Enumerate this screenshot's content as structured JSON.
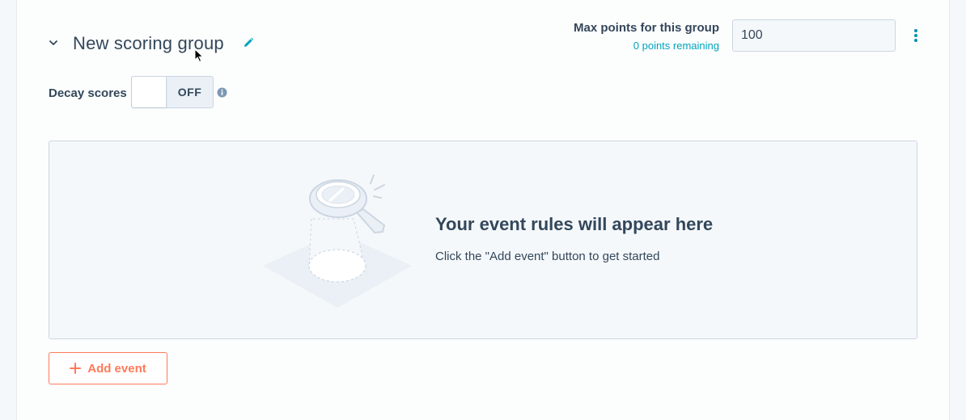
{
  "group": {
    "title": "New scoring group",
    "max_points_label": "Max points for this group",
    "points_remaining": "0 points remaining",
    "max_points_value": "100"
  },
  "decay": {
    "label": "Decay scores",
    "toggle_text": "OFF",
    "enabled": false
  },
  "empty_state": {
    "title": "Your event rules will appear here",
    "subtitle": "Click the \"Add event\" button to get started"
  },
  "actions": {
    "add_event_label": "Add event"
  },
  "icons": {
    "collapse": "chevron-down-icon",
    "edit": "pencil-icon",
    "more": "more-vertical-icon",
    "info": "info-icon",
    "add": "plus-icon",
    "illustration": "magnifying-glass-icon"
  },
  "colors": {
    "accent": "#ff7a59",
    "link": "#00a4bd",
    "text": "#33475b",
    "border": "#cbd6e2"
  }
}
